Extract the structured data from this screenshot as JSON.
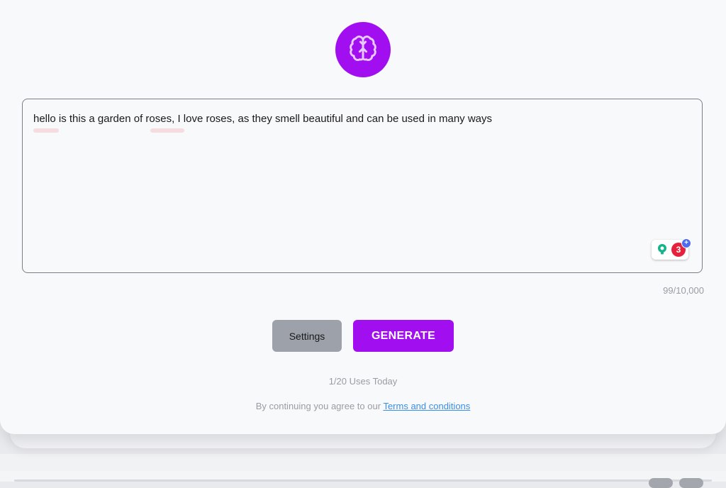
{
  "app": {
    "logo_icon": "brain-icon",
    "accent_color": "#a10ff0"
  },
  "editor": {
    "text": "hello is this a garden of roses, I love roses, as they smell beautiful and can be used in many ways",
    "char_count": "99/10,000",
    "grammarly": {
      "icon": "lightbulb-icon",
      "issue_count": "3",
      "plus_icon": "plus-icon"
    }
  },
  "actions": {
    "settings_label": "Settings",
    "generate_label": "GENERATE"
  },
  "usage": {
    "text": "1/20 Uses Today"
  },
  "footer": {
    "prefix": "By continuing you agree to our",
    "terms_link": "Terms and conditions"
  }
}
